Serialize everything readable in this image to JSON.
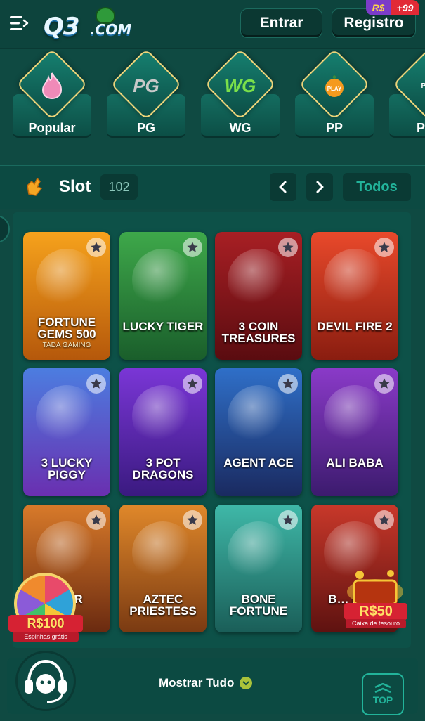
{
  "header": {
    "logo_text": "Q3",
    "logo_suffix": ".COM",
    "login_label": "Entrar",
    "register_label": "Registro",
    "register_badge_currency": "R$",
    "register_badge_amount": "+99"
  },
  "providers": [
    {
      "label": "Popular",
      "icon": "flame-icon"
    },
    {
      "label": "PG",
      "icon": "pg-logo-icon"
    },
    {
      "label": "WG",
      "icon": "wg-logo-icon"
    },
    {
      "label": "PP",
      "icon": "pp-play-icon"
    },
    {
      "label": "Pop",
      "icon": "pop-logo-icon"
    }
  ],
  "slot": {
    "title": "Slot",
    "count": "102",
    "all_label": "Todos"
  },
  "games": [
    {
      "title": "FORTUNE GEMS 500",
      "subtitle": "TADA GAMING",
      "color1": "#f6a21c",
      "color2": "#b5580b"
    },
    {
      "title": "LUCKY TIGER",
      "subtitle": "",
      "color1": "#3ea84a",
      "color2": "#1a5e2b"
    },
    {
      "title": "3 COIN TREASURES",
      "subtitle": "",
      "color1": "#a81f24",
      "color2": "#5a0c10"
    },
    {
      "title": "DEVIL FIRE 2",
      "subtitle": "",
      "color1": "#e9492b",
      "color2": "#8a1d10"
    },
    {
      "title": "3 LUCKY PIGGY",
      "subtitle": "",
      "color1": "#4c7de0",
      "color2": "#6a2fb0"
    },
    {
      "title": "3 POT DRAGONS",
      "subtitle": "",
      "color1": "#7a36d6",
      "color2": "#3a1a80"
    },
    {
      "title": "AGENT ACE",
      "subtitle": "",
      "color1": "#2f6fc8",
      "color2": "#1a2a60"
    },
    {
      "title": "ALI BABA",
      "subtitle": "",
      "color1": "#8a3ac8",
      "color2": "#3c1b6e"
    },
    {
      "title": "… ER",
      "subtitle": "",
      "color1": "#d87a2a",
      "color2": "#6a2a10"
    },
    {
      "title": "AZTEC PRIESTESS",
      "subtitle": "",
      "color1": "#e0882a",
      "color2": "#7a3a12"
    },
    {
      "title": "BONE FORTUNE",
      "subtitle": "",
      "color1": "#3fb8a8",
      "color2": "#1a5e58"
    },
    {
      "title": "B… HU…",
      "subtitle": "",
      "color1": "#c8382a",
      "color2": "#5e1210"
    }
  ],
  "promos": {
    "wheel_amount": "R$100",
    "wheel_caption": "Espinhas grátis",
    "chest_amount": "R$50",
    "chest_caption": "Caixa de tesouro"
  },
  "footer": {
    "show_all_label": "Mostrar Tudo",
    "top_label": "TOP"
  }
}
